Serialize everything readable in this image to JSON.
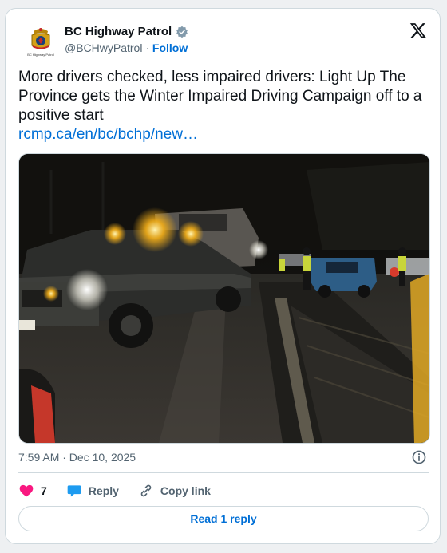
{
  "author": {
    "display_name": "BC Highway Patrol",
    "handle": "@BCHwyPatrol",
    "separator": " · ",
    "follow_label": "Follow",
    "verified_icon": "verified-badge-icon",
    "avatar_icon": "rcmp-crest-icon",
    "avatar_text": "BC Highway Patrol"
  },
  "platform_icon": "x-logo-icon",
  "tweet": {
    "text": "More drivers checked, less impaired drivers: Light Up The Province gets the Winter Impaired Driving Campaign off to a positive start",
    "link": "rcmp.ca/en/bc/bchp/new…"
  },
  "media": {
    "description_icon": "night-roadside-checkstop-photo"
  },
  "meta": {
    "timestamp": "7:59 AM · Dec 10, 2025",
    "info_icon": "info-icon"
  },
  "actions": {
    "like_count": "7",
    "reply_label": "Reply",
    "copy_link_label": "Copy link"
  },
  "read_reply_label": "Read 1 reply",
  "colors": {
    "link": "#006fd6",
    "like": "#f91880",
    "text": "#0f1419",
    "muted": "#536471",
    "verified": "#829aab"
  }
}
